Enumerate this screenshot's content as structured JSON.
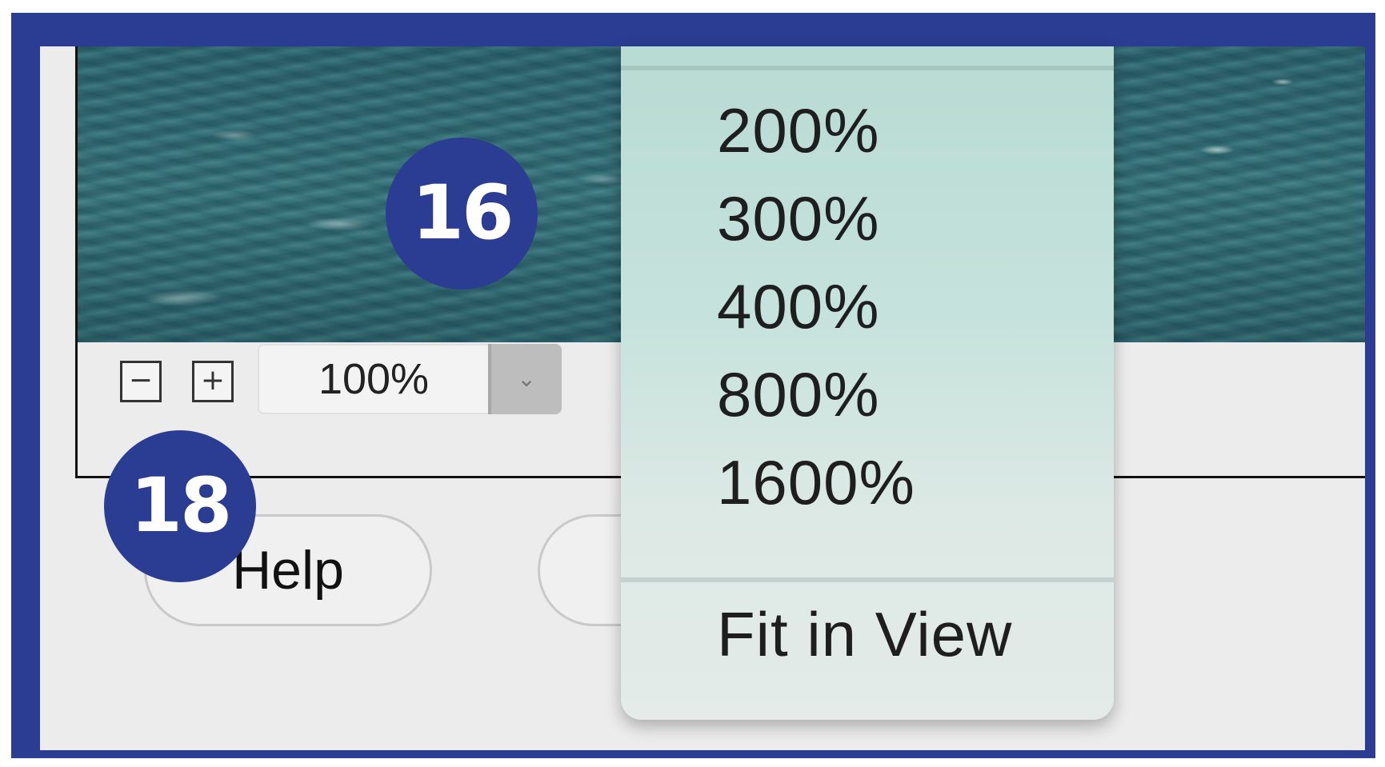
{
  "zoom": {
    "zoom_out_label": "−",
    "zoom_in_label": "+",
    "current_value": "100%",
    "arrow": "⌄"
  },
  "buttons": {
    "help_label": "Help"
  },
  "zoom_menu": {
    "items": [
      "200%",
      "300%",
      "400%",
      "800%",
      "1600%"
    ],
    "fit_label": "Fit in View"
  },
  "callouts": {
    "preview_callout": "16",
    "zoom_controls_callout": "18"
  },
  "colors": {
    "frame": "#2b3d93",
    "callout": "#2b3d93",
    "dialog_bg": "#ececec"
  }
}
